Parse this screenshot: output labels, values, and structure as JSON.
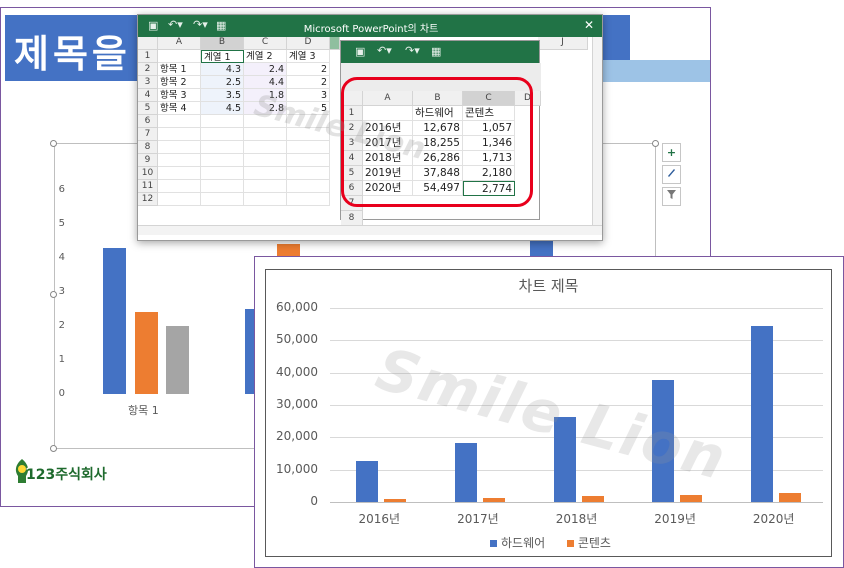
{
  "slide": {
    "title": "제목을 ",
    "logo_text": "123주식회사",
    "background_chart": {
      "yticks": [
        "6",
        "5",
        "4",
        "3",
        "2",
        "1",
        "0"
      ],
      "category_label": "항목 1",
      "side_buttons": [
        "plus-icon",
        "brush-icon",
        "filter-icon"
      ]
    }
  },
  "excel1": {
    "title": "Microsoft PowerPoint의 차트",
    "columns": [
      "A",
      "B",
      "C",
      "D"
    ],
    "header_row": [
      "",
      "계열 1",
      "계열 2",
      "계열 3"
    ],
    "rows": [
      [
        "항목 1",
        "4.3",
        "2.4",
        "2"
      ],
      [
        "항목 2",
        "2.5",
        "4.4",
        "2"
      ],
      [
        "항목 3",
        "3.5",
        "1.8",
        "3"
      ],
      [
        "항목 4",
        "4.5",
        "2.8",
        "5"
      ]
    ],
    "row_numbers": [
      "1",
      "2",
      "3",
      "4",
      "5",
      "6",
      "7",
      "8",
      "9",
      "10",
      "11",
      "12"
    ],
    "extra_column": "J"
  },
  "excel2": {
    "columns": [
      "A",
      "B",
      "C",
      "D"
    ],
    "header_row": [
      "",
      "하드웨어",
      "콘텐츠"
    ],
    "rows": [
      [
        "2016년",
        "12,678",
        "1,057"
      ],
      [
        "2017년",
        "18,255",
        "1,346"
      ],
      [
        "2018년",
        "26,286",
        "1,713"
      ],
      [
        "2019년",
        "37,848",
        "2,180"
      ],
      [
        "2020년",
        "54,497",
        "2,774"
      ]
    ],
    "row_numbers": [
      "1",
      "2",
      "3",
      "4",
      "5",
      "6",
      "7",
      "8"
    ]
  },
  "watermark": "Smile Lion",
  "colors": {
    "blue": "#4472c4",
    "orange": "#ed7d31",
    "gray": "#a5a5a5",
    "excel_green": "#217346",
    "highlight_red": "#e8001c"
  },
  "chart_data": {
    "type": "bar",
    "title": "차트 제목",
    "categories": [
      "2016년",
      "2017년",
      "2018년",
      "2019년",
      "2020년"
    ],
    "series": [
      {
        "name": "하드웨어",
        "values": [
          12678,
          18255,
          26286,
          37848,
          54497
        ],
        "color": "#4472c4"
      },
      {
        "name": "콘텐츠",
        "values": [
          1057,
          1346,
          1713,
          2180,
          2774
        ],
        "color": "#ed7d31"
      }
    ],
    "ylim": [
      0,
      60000
    ],
    "yticks": [
      "60,000",
      "50,000",
      "40,000",
      "30,000",
      "20,000",
      "10,000",
      "0"
    ],
    "grid": true,
    "legend": "bottom"
  },
  "background_chart_data": {
    "type": "bar",
    "categories": [
      "항목 1"
    ],
    "series": [
      {
        "name": "계열 1",
        "values": [
          4.3
        ]
      },
      {
        "name": "계열 2",
        "values": [
          2.4
        ]
      },
      {
        "name": "계열 3",
        "values": [
          2
        ]
      }
    ],
    "ylim": [
      0,
      6
    ]
  }
}
